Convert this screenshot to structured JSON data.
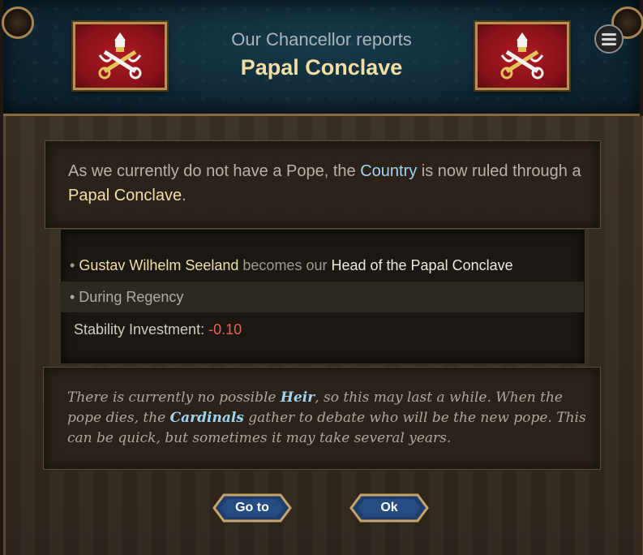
{
  "header": {
    "subtitle": "Our Chancellor reports",
    "title": "Papal Conclave"
  },
  "intro": {
    "part1": "As we currently do not have a Pope, the ",
    "country": "Country",
    "part2": " is now ruled through a ",
    "conclave": "Papal Conclave",
    "part3": "."
  },
  "effects": {
    "row1": {
      "bullet": "• ",
      "name": "Gustav Wilhelm Seeland",
      "mid": " becomes our ",
      "role": "Head of the Papal Conclave"
    },
    "row2": {
      "text": "• During Regency"
    },
    "row3": {
      "label": "Stability Investment",
      "sep": ": ",
      "value": "-0.10"
    }
  },
  "note": {
    "p1": "There is currently no possible ",
    "heir": "Heir",
    "p2": ", so this may last a while. When the pope dies, the ",
    "cardinals": "Cardinals",
    "p3": " gather to debate who will be the new pope. This can be quick, but sometimes it may take several years."
  },
  "buttons": {
    "goto": "Go to",
    "ok": "Ok"
  },
  "icons": {
    "menu": "menu-icon",
    "flag": "papal-keys-flag-icon"
  },
  "colors": {
    "accent": "#9fd4f0",
    "highlight": "#f4dfa6",
    "negative": "#e9605a"
  }
}
